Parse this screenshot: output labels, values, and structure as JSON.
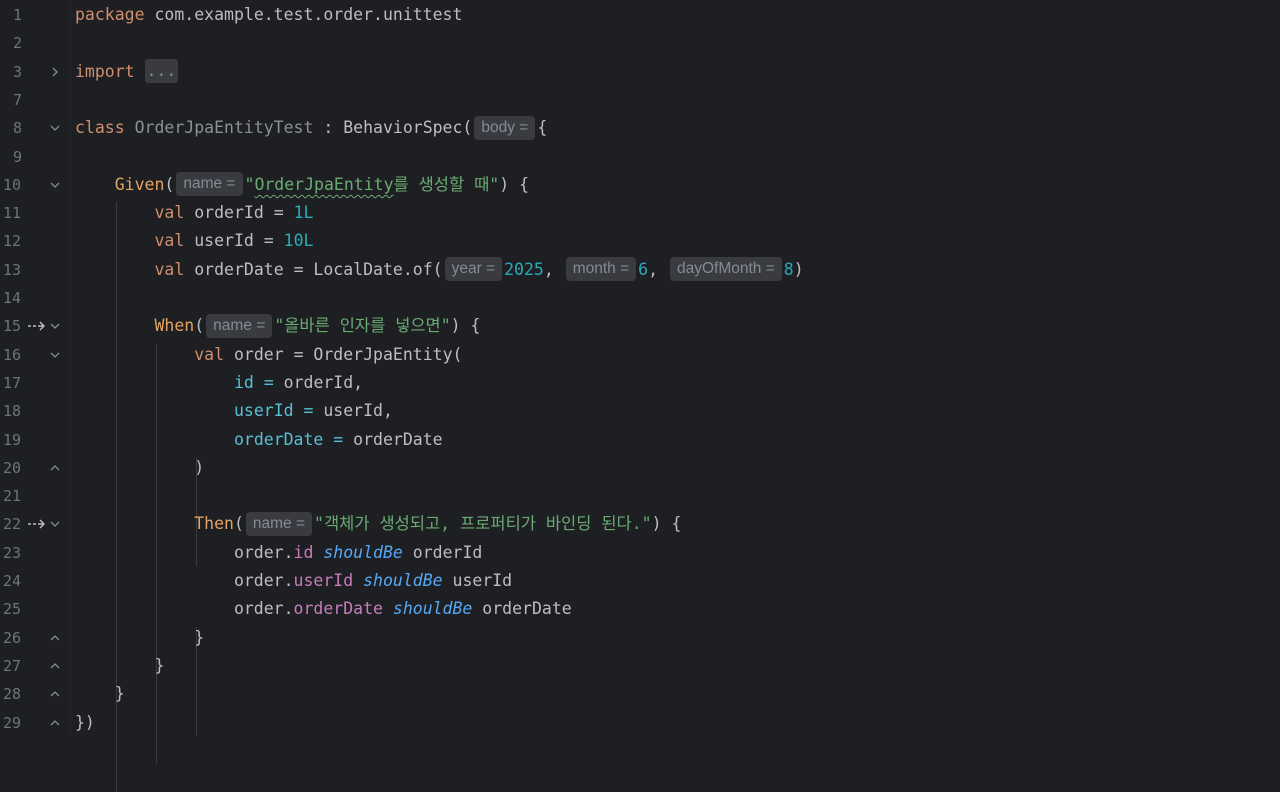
{
  "editor": {
    "language": "kotlin",
    "lines": [
      {
        "no": "1",
        "fold": "",
        "gutter_icon": "",
        "tokens": [
          {
            "t": "package",
            "c": "kw"
          },
          {
            "t": " com.example.test.order.unittest",
            "c": "id"
          }
        ]
      },
      {
        "no": "2",
        "fold": "",
        "gutter_icon": "",
        "tokens": []
      },
      {
        "no": "3",
        "fold": "collapsed",
        "gutter_icon": "",
        "tokens": [
          {
            "t": "import",
            "c": "kw"
          },
          {
            "t": " ",
            "c": "id"
          },
          {
            "t": "...",
            "c": "fold-box"
          }
        ]
      },
      {
        "no": "7",
        "fold": "",
        "gutter_icon": "",
        "tokens": []
      },
      {
        "no": "8",
        "fold": "expanded",
        "gutter_icon": "",
        "tokens": [
          {
            "t": "class",
            "c": "kw"
          },
          {
            "t": " ",
            "c": "id"
          },
          {
            "t": "OrderJpaEntityTest",
            "c": "cls-dim"
          },
          {
            "t": " : BehaviorSpec(",
            "c": "id"
          },
          {
            "t": "body =",
            "c": "hint"
          },
          {
            "t": "{",
            "c": "id"
          }
        ]
      },
      {
        "no": "9",
        "fold": "",
        "gutter_icon": "",
        "tokens": []
      },
      {
        "no": "10",
        "fold": "expanded",
        "gutter_icon": "",
        "tokens": [
          {
            "t": "    ",
            "c": "id"
          },
          {
            "t": "Given",
            "c": "fn"
          },
          {
            "t": "(",
            "c": "id"
          },
          {
            "t": "name =",
            "c": "hint"
          },
          {
            "t": "\"",
            "c": "str"
          },
          {
            "t": "OrderJpaEntity",
            "c": "str squig"
          },
          {
            "t": "를 생성할 때\"",
            "c": "str"
          },
          {
            "t": ") {",
            "c": "id"
          }
        ]
      },
      {
        "no": "11",
        "fold": "",
        "gutter_icon": "",
        "tokens": [
          {
            "t": "        ",
            "c": "id"
          },
          {
            "t": "val",
            "c": "kw"
          },
          {
            "t": " orderId = ",
            "c": "id"
          },
          {
            "t": "1L",
            "c": "num"
          }
        ]
      },
      {
        "no": "12",
        "fold": "",
        "gutter_icon": "",
        "tokens": [
          {
            "t": "        ",
            "c": "id"
          },
          {
            "t": "val",
            "c": "kw"
          },
          {
            "t": " userId = ",
            "c": "id"
          },
          {
            "t": "10L",
            "c": "num"
          }
        ]
      },
      {
        "no": "13",
        "fold": "",
        "gutter_icon": "",
        "tokens": [
          {
            "t": "        ",
            "c": "id"
          },
          {
            "t": "val",
            "c": "kw"
          },
          {
            "t": " orderDate = LocalDate.of(",
            "c": "id"
          },
          {
            "t": "year =",
            "c": "hint"
          },
          {
            "t": "2025",
            "c": "num"
          },
          {
            "t": ", ",
            "c": "id"
          },
          {
            "t": "month =",
            "c": "hint"
          },
          {
            "t": "6",
            "c": "num"
          },
          {
            "t": ", ",
            "c": "id"
          },
          {
            "t": "dayOfMonth =",
            "c": "hint"
          },
          {
            "t": "8",
            "c": "num"
          },
          {
            "t": ")",
            "c": "id"
          }
        ]
      },
      {
        "no": "14",
        "fold": "",
        "gutter_icon": "",
        "tokens": []
      },
      {
        "no": "15",
        "fold": "expanded",
        "gutter_icon": "step-into-icon",
        "tokens": [
          {
            "t": "        ",
            "c": "id"
          },
          {
            "t": "When",
            "c": "fn"
          },
          {
            "t": "(",
            "c": "id"
          },
          {
            "t": "name =",
            "c": "hint"
          },
          {
            "t": "\"올바른 인자를 넣으면\"",
            "c": "str"
          },
          {
            "t": ") {",
            "c": "id"
          }
        ]
      },
      {
        "no": "16",
        "fold": "expanded",
        "gutter_icon": "",
        "tokens": [
          {
            "t": "            ",
            "c": "id"
          },
          {
            "t": "val",
            "c": "kw"
          },
          {
            "t": " order = OrderJpaEntity(",
            "c": "id"
          }
        ]
      },
      {
        "no": "17",
        "fold": "",
        "gutter_icon": "",
        "tokens": [
          {
            "t": "                ",
            "c": "id"
          },
          {
            "t": "id",
            "c": "named"
          },
          {
            "t": " = ",
            "c": "named"
          },
          {
            "t": "orderId,",
            "c": "id"
          }
        ]
      },
      {
        "no": "18",
        "fold": "",
        "gutter_icon": "",
        "tokens": [
          {
            "t": "                ",
            "c": "id"
          },
          {
            "t": "userId",
            "c": "named"
          },
          {
            "t": " = ",
            "c": "named"
          },
          {
            "t": "userId,",
            "c": "id"
          }
        ]
      },
      {
        "no": "19",
        "fold": "",
        "gutter_icon": "",
        "tokens": [
          {
            "t": "                ",
            "c": "id"
          },
          {
            "t": "orderDate",
            "c": "named"
          },
          {
            "t": " = ",
            "c": "named"
          },
          {
            "t": "orderDate",
            "c": "id"
          }
        ]
      },
      {
        "no": "20",
        "fold": "end",
        "gutter_icon": "",
        "tokens": [
          {
            "t": "            )",
            "c": "id"
          }
        ]
      },
      {
        "no": "21",
        "fold": "",
        "gutter_icon": "",
        "tokens": []
      },
      {
        "no": "22",
        "fold": "expanded",
        "gutter_icon": "step-into-icon",
        "tokens": [
          {
            "t": "            ",
            "c": "id"
          },
          {
            "t": "Then",
            "c": "fn"
          },
          {
            "t": "(",
            "c": "id"
          },
          {
            "t": "name =",
            "c": "hint"
          },
          {
            "t": "\"객체가 생성되고, 프로퍼티가 바인딩 된다.\"",
            "c": "str"
          },
          {
            "t": ") {",
            "c": "id"
          }
        ]
      },
      {
        "no": "23",
        "fold": "",
        "gutter_icon": "",
        "tokens": [
          {
            "t": "                order.",
            "c": "id"
          },
          {
            "t": "id",
            "c": "prop"
          },
          {
            "t": " ",
            "c": "id"
          },
          {
            "t": "shouldBe",
            "c": "infix"
          },
          {
            "t": " orderId",
            "c": "id"
          }
        ]
      },
      {
        "no": "24",
        "fold": "",
        "gutter_icon": "",
        "tokens": [
          {
            "t": "                order.",
            "c": "id"
          },
          {
            "t": "userId",
            "c": "prop"
          },
          {
            "t": " ",
            "c": "id"
          },
          {
            "t": "shouldBe",
            "c": "infix"
          },
          {
            "t": " userId",
            "c": "id"
          }
        ]
      },
      {
        "no": "25",
        "fold": "",
        "gutter_icon": "",
        "tokens": [
          {
            "t": "                order.",
            "c": "id"
          },
          {
            "t": "orderDate",
            "c": "prop"
          },
          {
            "t": " ",
            "c": "id"
          },
          {
            "t": "shouldBe",
            "c": "infix"
          },
          {
            "t": " orderDate",
            "c": "id"
          }
        ]
      },
      {
        "no": "26",
        "fold": "end",
        "gutter_icon": "",
        "tokens": [
          {
            "t": "            }",
            "c": "id"
          }
        ]
      },
      {
        "no": "27",
        "fold": "end",
        "gutter_icon": "",
        "tokens": [
          {
            "t": "        }",
            "c": "id"
          }
        ]
      },
      {
        "no": "28",
        "fold": "end",
        "gutter_icon": "",
        "tokens": [
          {
            "t": "    }",
            "c": "id"
          }
        ]
      },
      {
        "no": "29",
        "fold": "end",
        "gutter_icon": "",
        "tokens": [
          {
            "t": "})",
            "c": "id"
          }
        ]
      }
    ]
  },
  "colors": {
    "background": "#1e1f22",
    "keyword": "#cf8e6d",
    "string": "#6aab73",
    "number": "#2aacb8",
    "property": "#c77dbb",
    "function_call": "#e2a363",
    "named_argument": "#56c1d6",
    "infix_function": "#56a8f5",
    "inlay_hint_bg": "#393b40",
    "line_number": "#6f737a"
  }
}
